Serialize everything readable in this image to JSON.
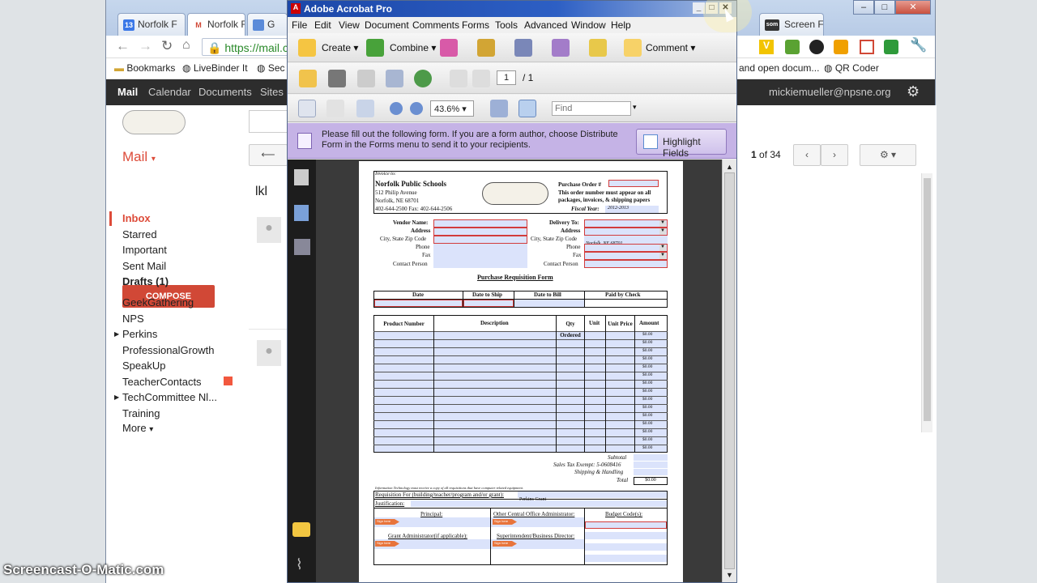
{
  "browser": {
    "tabs": [
      {
        "label": "Norfolk F",
        "icon": "13"
      },
      {
        "label": "Norfolk F",
        "icon": "M"
      },
      {
        "label": "G",
        "icon": ""
      },
      {
        "label": "Screen F",
        "icon": "som"
      }
    ],
    "address": "https://mail.c",
    "bookmarks": [
      "Bookmarks",
      "LiveBinder It",
      "Sec",
      "and open docum...",
      "QR Coder"
    ],
    "window_controls": [
      "–",
      "□",
      "✕"
    ]
  },
  "gmail": {
    "nav": [
      "Mail",
      "Calendar",
      "Documents",
      "Sites"
    ],
    "account": "mickiemueller@npsne.org",
    "mail_label": "Mail",
    "compose": "COMPOSE",
    "folders": [
      "Inbox",
      "Starred",
      "Important",
      "Sent Mail",
      "Drafts (1)"
    ],
    "labels": [
      "GeekGathering",
      "NPS",
      "Perkins",
      "ProfessionalGrowth",
      "SpeakUp",
      "TeacherContacts",
      "TechCommittee Nl...",
      "Training",
      "More"
    ],
    "preview_text": "lkl",
    "pager": "1",
    "pager_total": "of 34"
  },
  "acrobat": {
    "title": "Adobe Acrobat Pro",
    "menu": [
      "File",
      "Edit",
      "View",
      "Document",
      "Comments",
      "Forms",
      "Tools",
      "Advanced",
      "Window",
      "Help"
    ],
    "toolbar": {
      "create": "Create",
      "combine": "Combine",
      "comment": "Comment"
    },
    "page_current": "1",
    "page_total": "/ 1",
    "zoom": "43.6%",
    "find_placeholder": "Find",
    "form_message": "Please fill out the following form. If you are a form author, choose Distribute Form in the Forms menu to send it to your recipients.",
    "highlight_fields": "Highlight Fields"
  },
  "pdf": {
    "invoice_to": "Invoice to:",
    "org": "Norfolk Public Schools",
    "addr1": "512 Philip Avenue",
    "addr2": "Norfolk, NE  68701",
    "phone": "402-644-2500    Fax: 402-644-2506",
    "po_label": "Purchase Order #",
    "po_note1": "This order number must appear on all",
    "po_note2": "packages, invoices, & shipping papers",
    "fiscal_label": "Fiscal Year:",
    "fiscal_value": "2012-2013",
    "vendor_labels": [
      "Vendor Name:",
      "Address",
      "City, State Zip Code",
      "Phone",
      "Fax",
      "Contact Person"
    ],
    "delivery_labels": [
      "Delivery To:",
      "Address",
      "City, State Zip Code",
      "Phone",
      "Fax",
      "Contact Person"
    ],
    "delivery_city_value": "Norfolk, NE  68701",
    "form_title": "Purchase Requisition Form",
    "date_headers": [
      "Date",
      "Date to Ship",
      "Date to Bill",
      "Paid by Check"
    ],
    "item_headers": [
      "Product Number",
      "Description",
      "Qty Ordered",
      "Unit",
      "Unit Price",
      "Amount"
    ],
    "amount_value": "$0.00",
    "totals_labels": [
      "Subtotal",
      "Sales Tax Exempt:  5-0608416",
      "Shipping & Handling",
      "Total"
    ],
    "info_note": "Information Technology must receive a copy of all requisitions that have computer related equipment.",
    "req_for": "Requisition For (building/teacher/program and/or grant):",
    "req_for_value": "Perkins Grant",
    "justification": "Justification:",
    "sign_labels": [
      "Principal:",
      "Other Central Office Administrator:",
      "Budget Code(s):",
      "Grant Administrator(if applicable):",
      "Superintendent/Business Director:"
    ],
    "sign_here": "Sign here"
  },
  "watermark": "Screencast-O-Matic.com"
}
